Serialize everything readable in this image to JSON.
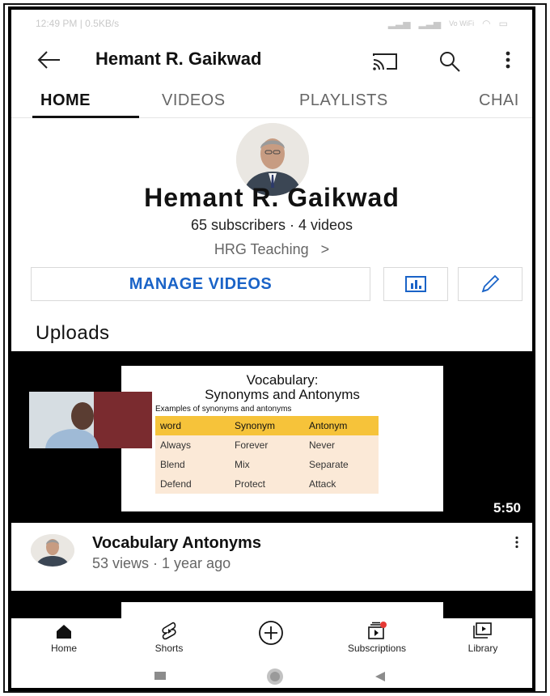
{
  "status_bar": {
    "left": "12:49 PM | 0.5KB/s",
    "right": "Vo WiFi"
  },
  "appbar": {
    "title": "Hemant R. Gaikwad"
  },
  "tabs": [
    {
      "label": "HOME",
      "active": true
    },
    {
      "label": "VIDEOS"
    },
    {
      "label": "PLAYLISTS"
    },
    {
      "label": "CHAI"
    }
  ],
  "channel": {
    "name": "Hemant R. Gaikwad",
    "stats": "65 subscribers · 4 videos",
    "link": "HRG Teaching",
    "link_chevron": ">"
  },
  "actions": {
    "manage_label": "MANAGE VIDEOS"
  },
  "uploads": {
    "title": "Uploads"
  },
  "video": {
    "slide_title_line1": "Vocabulary:",
    "slide_title_line2": "Synonyms and Antonyms",
    "slide_subtitle": "Examples of synonyms and antonyms",
    "table_header": [
      "word",
      "Synonym",
      "Antonym"
    ],
    "table_rows": [
      [
        "Always",
        "Forever",
        "Never"
      ],
      [
        "Blend",
        "Mix",
        "Separate"
      ],
      [
        "Defend",
        "Protect",
        "Attack"
      ]
    ],
    "duration": "5:50",
    "title": "Vocabulary Antonyms",
    "meta": "53 views · 1 year ago"
  },
  "bottom_nav": [
    {
      "label": "Home",
      "icon": "home-icon"
    },
    {
      "label": "Shorts",
      "icon": "shorts-icon"
    },
    {
      "label": "",
      "icon": "create-icon"
    },
    {
      "label": "Subscriptions",
      "icon": "subscriptions-icon"
    },
    {
      "label": "Library",
      "icon": "library-icon"
    }
  ],
  "colors": {
    "accent_blue": "#1a63c7",
    "table_header": "#f6c33a",
    "table_row": "#fbe9d7",
    "notification_dot": "#e53935"
  }
}
